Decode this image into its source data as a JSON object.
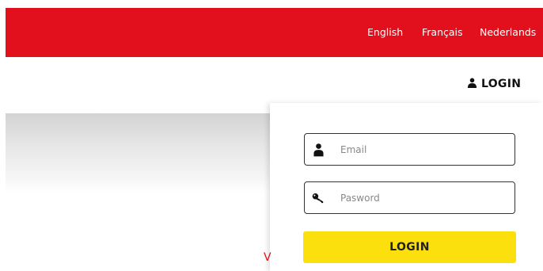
{
  "header": {
    "languages": [
      "English",
      "Français",
      "Nederlands"
    ],
    "login_link": "LOGIN",
    "login_icon": "user-icon",
    "brand_color": "#e2101c"
  },
  "banner": {
    "partial_text": "V"
  },
  "login_form": {
    "email_placeholder": "Email",
    "email_icon": "user-icon",
    "password_placeholder": "Pasword",
    "password_icon": "key-icon",
    "submit_label": "LOGIN",
    "submit_color": "#fce00e"
  }
}
